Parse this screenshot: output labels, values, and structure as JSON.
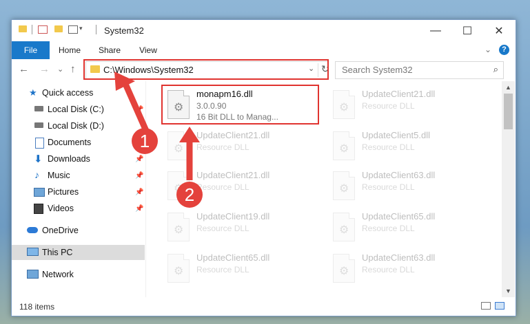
{
  "window": {
    "title": "System32",
    "minimize": "—",
    "maximize": "☐",
    "close": "✕"
  },
  "ribbon": {
    "tabs": [
      "File",
      "Home",
      "Share",
      "View"
    ],
    "collapse": "⌄",
    "help": "?"
  },
  "address": {
    "path": "C:\\Windows\\System32",
    "dropdown": "⌄",
    "refresh": "↻"
  },
  "search": {
    "placeholder": "Search System32",
    "icon": "⌕"
  },
  "nav": {
    "back": "←",
    "forward": "→",
    "recent": "⌄",
    "up": "↑"
  },
  "sidebar": {
    "items": [
      {
        "label": "Quick access",
        "icon": "star-icon",
        "pinned": false
      },
      {
        "label": "Local Disk (C:)",
        "icon": "drive-icon",
        "pinned": true
      },
      {
        "label": "Local Disk (D:)",
        "icon": "drive-icon",
        "pinned": false
      },
      {
        "label": "Documents",
        "icon": "document-icon",
        "pinned": false
      },
      {
        "label": "Downloads",
        "icon": "download-icon",
        "pinned": true
      },
      {
        "label": "Music",
        "icon": "music-icon",
        "pinned": true
      },
      {
        "label": "Pictures",
        "icon": "picture-icon",
        "pinned": true
      },
      {
        "label": "Videos",
        "icon": "video-icon",
        "pinned": true
      },
      {
        "label": "OneDrive",
        "icon": "cloud-icon",
        "pinned": false
      },
      {
        "label": "This PC",
        "icon": "computer-icon",
        "pinned": false,
        "selected": true
      },
      {
        "label": "Network",
        "icon": "network-icon",
        "pinned": false
      }
    ]
  },
  "files": {
    "highlighted": {
      "name": "monapm16.dll",
      "version": "3.0.0.90",
      "description": "16 Bit DLL to Manag..."
    },
    "faded": [
      {
        "name": "UpdateClient21.dll",
        "type": "Resource DLL"
      },
      {
        "name": "UpdateClient21.dll",
        "type": "Resource DLL"
      },
      {
        "name": "UpdateClient5.dll",
        "type": "Resource DLL"
      },
      {
        "name": "UpdateClient21.dll",
        "type": "Resource DLL"
      },
      {
        "name": "UpdateClient63.dll",
        "type": "Resource DLL"
      },
      {
        "name": "UpdateClient19.dll",
        "type": "Resource DLL"
      },
      {
        "name": "UpdateClient65.dll",
        "type": "Resource DLL"
      },
      {
        "name": "UpdateClient65.dll",
        "type": "Resource DLL"
      },
      {
        "name": "UpdateClient63.dll",
        "type": "Resource DLL"
      }
    ]
  },
  "status": {
    "item_count": "118 items"
  },
  "annotations": {
    "step1": "1",
    "step2": "2",
    "color": "#e4423c"
  },
  "colors": {
    "accent": "#1979ca",
    "highlight_red": "#e0332f"
  }
}
